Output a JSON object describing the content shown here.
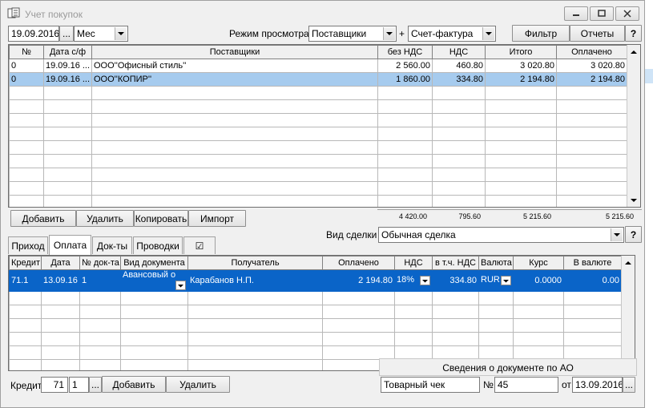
{
  "window": {
    "title": "Учет покупок",
    "caption_min": "–",
    "caption_max": "□",
    "caption_close": "✕"
  },
  "toolbar": {
    "date": "19.09.2016",
    "date_btn": "...",
    "period": "Мес",
    "view_mode_label": "Режим просмотра:",
    "view_mode": "Поставщики",
    "plus": "+",
    "doc_type": "Счет-фактура",
    "filter_btn": "Фильтр",
    "reports_btn": "Отчеты",
    "help_btn": "?"
  },
  "suppliers_table": {
    "columns": [
      "№",
      "Дата с/ф",
      "Поставщики",
      "без НДС",
      "НДС",
      "Итого",
      "Оплачено"
    ],
    "rows": [
      {
        "num": "0",
        "date": "19.09.16 ...",
        "supplier": "ООО''Офисный стиль''",
        "net": "2 560.00",
        "vat": "460.80",
        "total": "3 020.80",
        "paid": "3 020.80"
      },
      {
        "num": "0",
        "date": "19.09.16 ...",
        "supplier": "ООО''КОПИР''",
        "net": "1 860.00",
        "vat": "334.80",
        "total": "2 194.80",
        "paid": "2 194.80"
      }
    ],
    "totals": {
      "net": "4 420.00",
      "vat": "795.60",
      "total": "5 215.60",
      "paid": "5 215.60"
    }
  },
  "actions": {
    "add": "Добавить",
    "delete": "Удалить",
    "copy": "Копировать",
    "import": "Импорт"
  },
  "deal": {
    "label": "Вид сделки",
    "value": "Обычная сделка",
    "help": "?"
  },
  "tabs": {
    "income": "Приход",
    "payment": "Оплата",
    "docs": "Док-ты",
    "postings": "Проводки",
    "check": "☑"
  },
  "payments_table": {
    "columns": [
      "Кредит",
      "Дата",
      "№ док-та",
      "Вид документа",
      "Получатель",
      "Оплачено",
      "НДС",
      "в т.ч. НДС",
      "Валюта",
      "Курс",
      "В валюте"
    ],
    "rows": [
      {
        "credit": "71.1",
        "date": "13.09.16",
        "docnum": "1",
        "doctype": "Авансовый о",
        "recipient": "Карабанов Н.П.",
        "paid": "2 194.80",
        "vat_rate": "18%",
        "vat_incl": "334.80",
        "currency": "RUR",
        "rate": "0.0000",
        "in_currency": "0.00"
      }
    ]
  },
  "ao_info": {
    "title": "Сведения о документе по АО",
    "doc_kind": "Товарный чек",
    "num_label": "№",
    "num": "45",
    "from_label": "от",
    "date": "13.09.2016",
    "date_btn": "..."
  },
  "bottom": {
    "credit_label": "Кредит",
    "credit_acc": "71",
    "credit_sub": "1",
    "sub_btn": "...",
    "add": "Добавить",
    "delete": "Удалить"
  }
}
